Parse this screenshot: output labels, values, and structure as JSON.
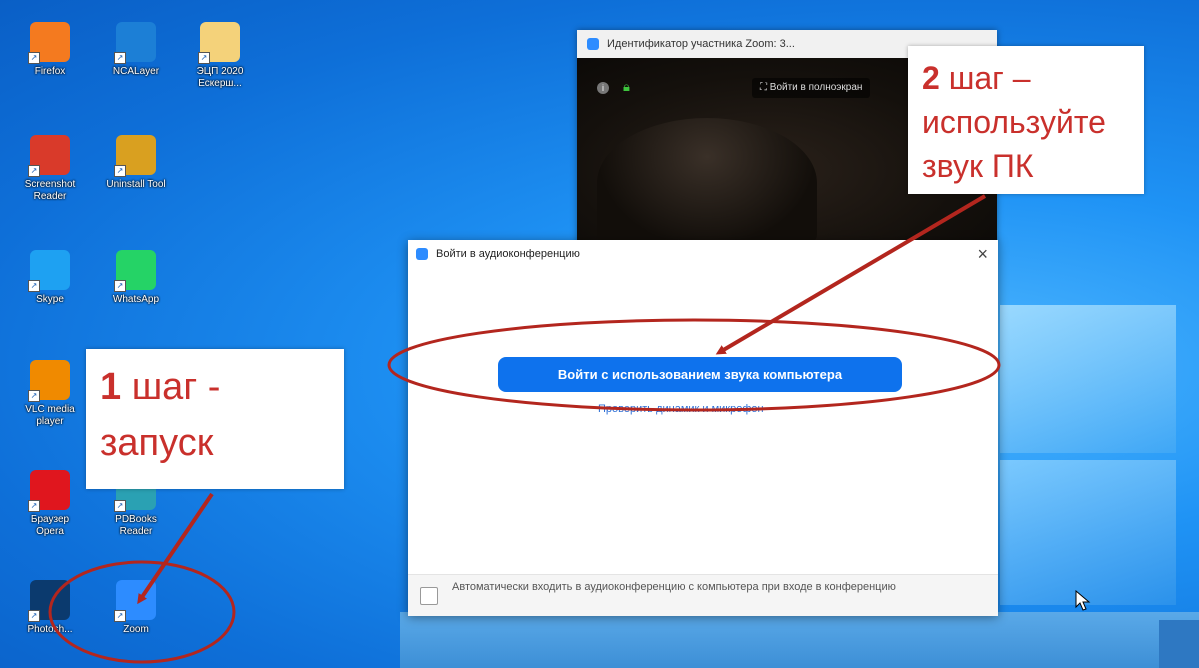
{
  "desktop": {
    "icons": [
      {
        "label": "Firefox",
        "icon": "firefox-icon",
        "color": "#f47a1f"
      },
      {
        "label": "NCALayer",
        "icon": "ncalayer-icon",
        "color": "#1c7fd6"
      },
      {
        "label": "ЭЦП 2020",
        "sublabel": "Ескерш...",
        "icon": "folder-icon",
        "color": "#f4d27a"
      },
      {
        "label": "Screenshot",
        "sublabel": "Reader",
        "icon": "screenshot-reader-icon",
        "color": "#d93a2a"
      },
      {
        "label": "Uninstall Tool",
        "icon": "uninstall-tool-icon",
        "color": "#d9a020"
      },
      {
        "label": "Skype",
        "icon": "skype-icon",
        "color": "#1ea1f2"
      },
      {
        "label": "WhatsApp",
        "icon": "whatsapp-icon",
        "color": "#25d366"
      },
      {
        "label": "VLC media",
        "sublabel": "player",
        "icon": "vlc-icon",
        "color": "#f08a00"
      },
      {
        "label": "Браузер",
        "sublabel": "Opera",
        "icon": "opera-icon",
        "color": "#e0161e"
      },
      {
        "label": "PDBooks",
        "sublabel": "Reader",
        "icon": "pdbooks-icon",
        "color": "#2aa1b3"
      },
      {
        "label": "Photosh...",
        "icon": "photoshop-icon",
        "color": "#0b3a6e"
      },
      {
        "label": "Zoom",
        "icon": "zoom-icon",
        "color": "#2d8cff"
      }
    ]
  },
  "video_window": {
    "title": "Идентификатор участника Zoom: 3...",
    "fullscreen_label": "Войти в полноэкран"
  },
  "audio_dialog": {
    "title": "Войти в аудиоконференцию",
    "close_glyph": "×",
    "join_button": "Войти с использованием звука компьютера",
    "test_link": "Проверить динамик и микрофон",
    "auto_join_text": "Автоматически входить в аудиоконференцию с компьютера при входе в конференцию"
  },
  "callouts": {
    "step1_line1_num": "1",
    "step1_line1_rest": " шаг -",
    "step1_line2": "запуск",
    "step2_line1_num": "2",
    "step2_line1_rest": " шаг –",
    "step2_line2": "используйте",
    "step2_line3": "звук ПК"
  },
  "colors": {
    "accent_red": "#c9302c",
    "zoom_blue": "#0e72ed"
  }
}
